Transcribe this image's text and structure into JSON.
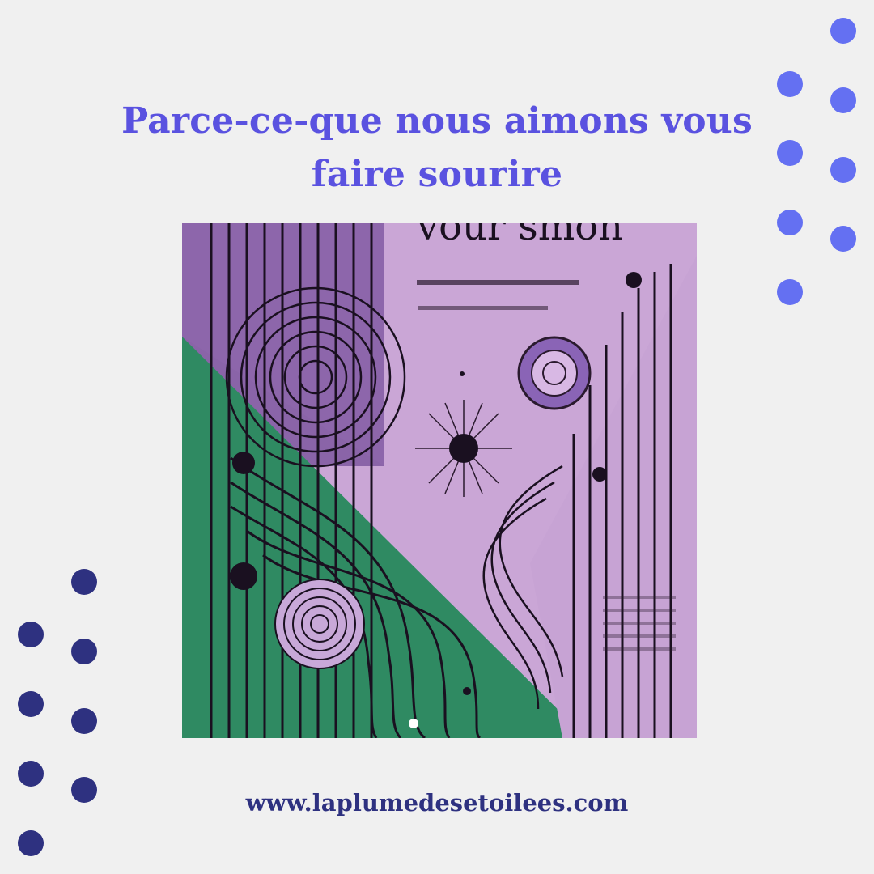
{
  "headline": {
    "line1": "Parce-ce-que nous aimons vous",
    "line2": "faire sourire"
  },
  "artwork": {
    "text": "vour smon",
    "icon": "abstract-art-image"
  },
  "footer": {
    "url": "www.laplumedesetoilees.com"
  },
  "colors": {
    "background": "#f0f0f0",
    "headline": "#5a52e0",
    "dots_top_right": "#6470f2",
    "dots_bottom_left": "#2e3180",
    "url": "#2e3180",
    "art_purple": "#8a64a8",
    "art_lilac": "#caa6d6",
    "art_green": "#2f8a62"
  }
}
